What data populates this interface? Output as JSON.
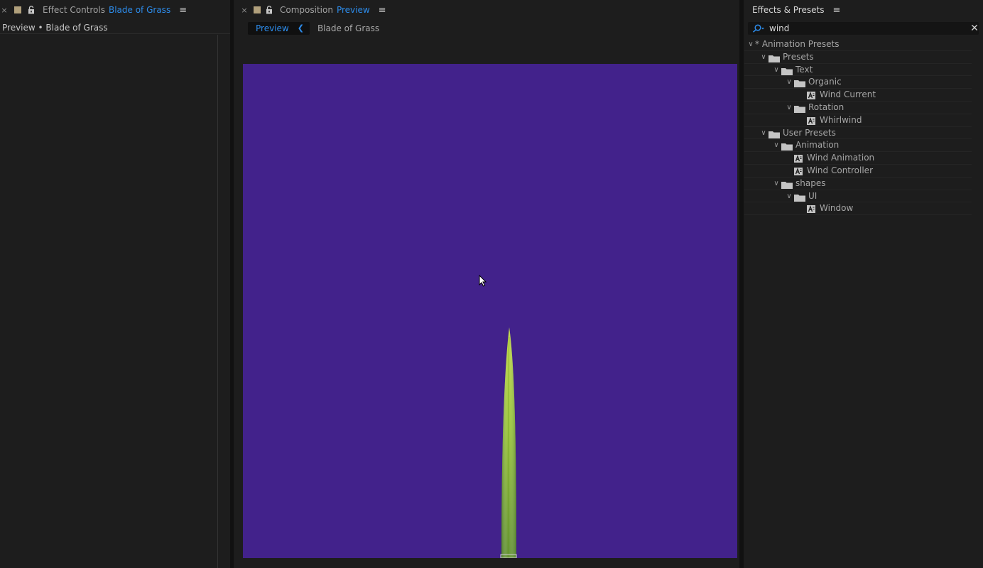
{
  "effect_controls": {
    "tab_close": "×",
    "tab_type": "Effect Controls",
    "tab_name": "Blade of Grass",
    "subheader": "Preview • Blade of Grass"
  },
  "composition": {
    "tab_close": "×",
    "tab_type": "Composition",
    "tab_name": "Preview",
    "nav_active": "Preview",
    "nav_next": "Blade of Grass",
    "canvas_color": "#42228b"
  },
  "effects_presets": {
    "title": "Effects & Presets",
    "search_value": "wind",
    "tree": [
      {
        "label": "* Animation Presets",
        "type": "root",
        "level": 0
      },
      {
        "label": "Presets",
        "type": "folder",
        "level": 1
      },
      {
        "label": "Text",
        "type": "folder",
        "level": 2
      },
      {
        "label": "Organic",
        "type": "folder",
        "level": 3
      },
      {
        "label": "Wind Current",
        "type": "preset",
        "level": 4
      },
      {
        "label": "Rotation",
        "type": "folder",
        "level": 3
      },
      {
        "label": "Whirlwind",
        "type": "preset",
        "level": 4
      },
      {
        "label": "User Presets",
        "type": "folder",
        "level": 1
      },
      {
        "label": "Animation",
        "type": "folder",
        "level": 2
      },
      {
        "label": "Wind Animation",
        "type": "preset",
        "level": 3
      },
      {
        "label": "Wind Controller",
        "type": "preset",
        "level": 3
      },
      {
        "label": "shapes",
        "type": "folder",
        "level": 2
      },
      {
        "label": "UI",
        "type": "folder",
        "level": 3
      },
      {
        "label": "Window",
        "type": "preset",
        "level": 4
      }
    ]
  },
  "colors": {
    "accent_blue": "#2d8ceb",
    "panel_bg": "#1d1d1d",
    "canvas_purple": "#42228b",
    "grass_green": "#8cbd32"
  },
  "icons": {
    "close": "close-icon",
    "swatch": "label-color-swatch",
    "lock": "lock-icon",
    "menu": "panel-menu-icon",
    "search": "search-icon",
    "clear": "clear-search-icon",
    "folder": "folder-icon",
    "preset": "animation-preset-icon",
    "twirl": "chevron-down-icon",
    "cursor": "mouse-cursor-icon"
  }
}
